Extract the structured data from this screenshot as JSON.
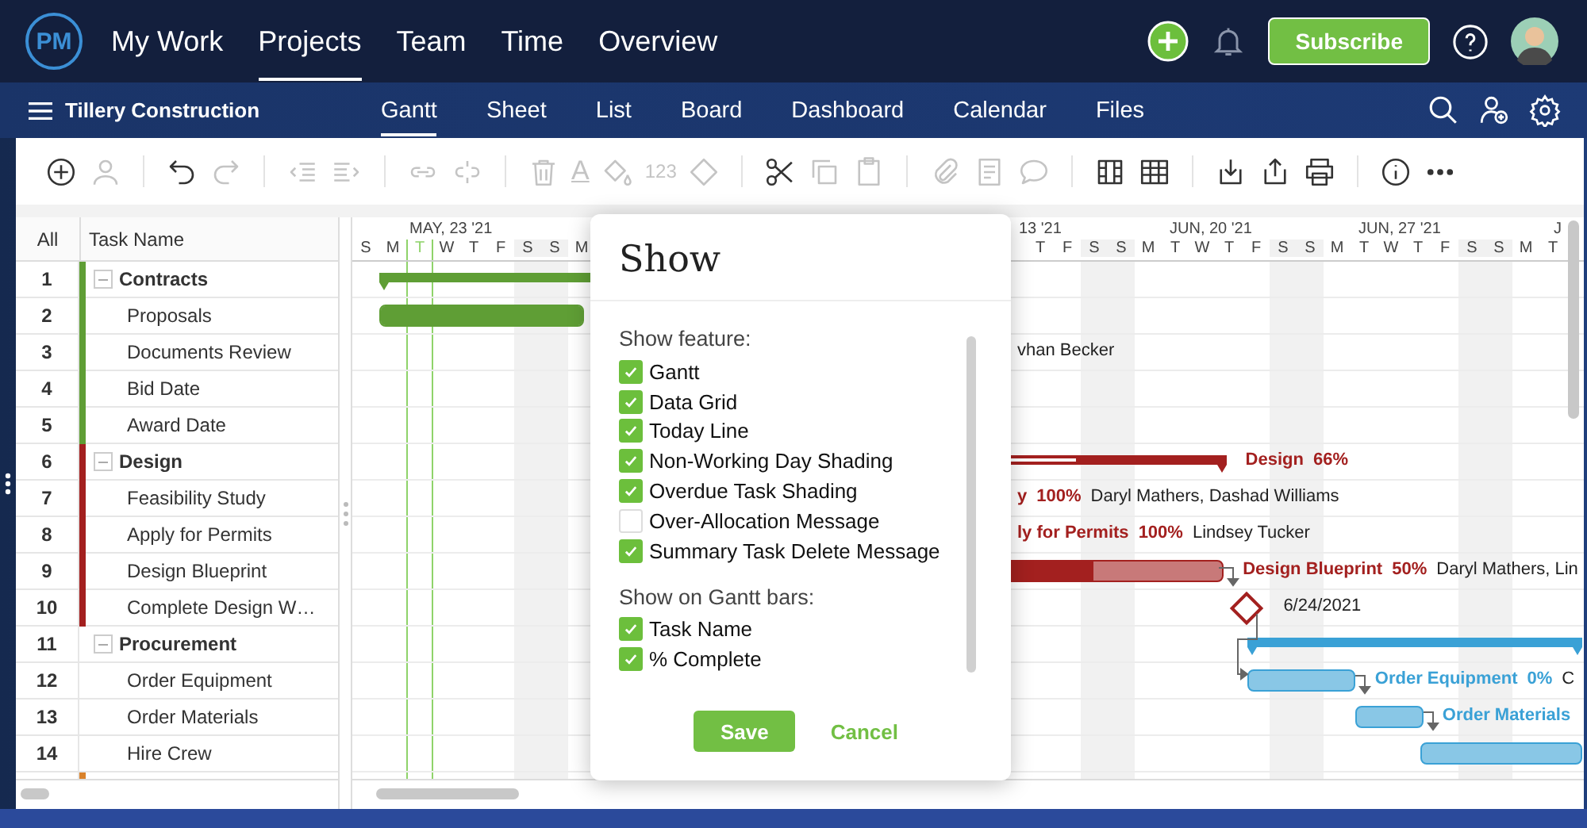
{
  "nav": {
    "logo": "PM",
    "items": [
      {
        "label": "My Work",
        "selected": false
      },
      {
        "label": "Projects",
        "selected": true
      },
      {
        "label": "Team",
        "selected": false
      },
      {
        "label": "Time",
        "selected": false
      },
      {
        "label": "Overview",
        "selected": false
      }
    ],
    "subscribe": "Subscribe"
  },
  "project": {
    "name": "Tillery Construction",
    "tabs": [
      {
        "label": "Gantt",
        "selected": true
      },
      {
        "label": "Sheet",
        "selected": false
      },
      {
        "label": "List",
        "selected": false
      },
      {
        "label": "Board",
        "selected": false
      },
      {
        "label": "Dashboard",
        "selected": false
      },
      {
        "label": "Calendar",
        "selected": false
      },
      {
        "label": "Files",
        "selected": false
      }
    ]
  },
  "toolbar": [
    {
      "items": [
        {
          "kind": "add",
          "disabled": false
        },
        {
          "kind": "assign",
          "disabled": true
        }
      ]
    },
    {
      "items": [
        {
          "kind": "undo",
          "disabled": false
        },
        {
          "kind": "redo",
          "disabled": true
        }
      ]
    },
    {
      "items": [
        {
          "kind": "outdent",
          "disabled": true
        },
        {
          "kind": "indent",
          "disabled": true
        }
      ]
    },
    {
      "items": [
        {
          "kind": "link",
          "disabled": true
        },
        {
          "kind": "unlink",
          "disabled": true
        }
      ]
    },
    {
      "items": [
        {
          "kind": "delete",
          "disabled": true
        },
        {
          "kind": "font",
          "text": "A",
          "disabled": true
        },
        {
          "kind": "bucket",
          "disabled": true
        },
        {
          "kind": "number",
          "text": "123",
          "disabled": true
        },
        {
          "kind": "milestone",
          "disabled": true
        }
      ]
    },
    {
      "items": [
        {
          "kind": "cut",
          "disabled": false
        },
        {
          "kind": "copy",
          "disabled": true
        },
        {
          "kind": "paste",
          "disabled": true
        }
      ]
    },
    {
      "items": [
        {
          "kind": "attach",
          "disabled": true
        },
        {
          "kind": "notes",
          "disabled": true
        },
        {
          "kind": "comment",
          "disabled": true
        }
      ]
    },
    {
      "items": [
        {
          "kind": "columns",
          "disabled": false
        },
        {
          "kind": "table",
          "disabled": false
        }
      ]
    },
    {
      "items": [
        {
          "kind": "import",
          "disabled": false
        },
        {
          "kind": "export",
          "disabled": false
        },
        {
          "kind": "print",
          "disabled": false
        }
      ]
    },
    {
      "items": [
        {
          "kind": "info",
          "disabled": false
        },
        {
          "kind": "more",
          "disabled": false
        }
      ]
    }
  ],
  "grid": {
    "columns": [
      "All",
      "Task Name"
    ],
    "rows": [
      {
        "num": "1",
        "name": "Contracts",
        "kind": "group",
        "expanded": true,
        "color": "#5f9e35"
      },
      {
        "num": "2",
        "name": "Proposals",
        "kind": "task",
        "color": "#5f9e35"
      },
      {
        "num": "3",
        "name": "Documents Review",
        "kind": "task",
        "color": "#5f9e35"
      },
      {
        "num": "4",
        "name": "Bid Date",
        "kind": "task",
        "color": "#5f9e35"
      },
      {
        "num": "5",
        "name": "Award Date",
        "kind": "task",
        "color": "#5f9e35"
      },
      {
        "num": "6",
        "name": "Design",
        "kind": "group",
        "expanded": true,
        "color": "#a3201f"
      },
      {
        "num": "7",
        "name": "Feasibility Study",
        "kind": "task",
        "color": "#a3201f"
      },
      {
        "num": "8",
        "name": "Apply for Permits",
        "kind": "task",
        "color": "#a3201f"
      },
      {
        "num": "9",
        "name": "Design Blueprint",
        "kind": "task",
        "color": "#a3201f"
      },
      {
        "num": "10",
        "name": "Complete Design W…",
        "kind": "task",
        "color": "#a3201f"
      },
      {
        "num": "11",
        "name": "Procurement",
        "kind": "group",
        "expanded": true
      },
      {
        "num": "12",
        "name": "Order Equipment",
        "kind": "task"
      },
      {
        "num": "13",
        "name": "Order Materials",
        "kind": "task"
      },
      {
        "num": "14",
        "name": "Hire Crew",
        "kind": "task"
      }
    ],
    "cut_row": {
      "color": "#d9822b"
    }
  },
  "gantt": {
    "weeks": [
      "MAY, 23 '21",
      "13 '21",
      "JUN, 20 '21",
      "JUN, 27 '21",
      "J"
    ],
    "days_left": [
      {
        "label": "S",
        "weekend": false,
        "today": false
      },
      {
        "label": "M",
        "weekend": false,
        "today": false
      },
      {
        "label": "T",
        "weekend": false,
        "today": true
      },
      {
        "label": "W",
        "weekend": false,
        "today": false
      },
      {
        "label": "T",
        "weekend": false,
        "today": false
      },
      {
        "label": "F",
        "weekend": false,
        "today": false
      },
      {
        "label": "S",
        "weekend": true,
        "today": false
      },
      {
        "label": "S",
        "weekend": true,
        "today": false
      },
      {
        "label": "M",
        "weekend": false,
        "today": false
      }
    ],
    "days_right": [
      {
        "label": "T",
        "weekend": false
      },
      {
        "label": "F",
        "weekend": false
      },
      {
        "label": "S",
        "weekend": true
      },
      {
        "label": "S",
        "weekend": true
      },
      {
        "label": "M",
        "weekend": false
      },
      {
        "label": "T",
        "weekend": false
      },
      {
        "label": "W",
        "weekend": false
      },
      {
        "label": "T",
        "weekend": false
      },
      {
        "label": "F",
        "weekend": false
      },
      {
        "label": "S",
        "weekend": true
      },
      {
        "label": "S",
        "weekend": true
      },
      {
        "label": "M",
        "weekend": false
      },
      {
        "label": "T",
        "weekend": false
      },
      {
        "label": "W",
        "weekend": false
      },
      {
        "label": "T",
        "weekend": false
      },
      {
        "label": "F",
        "weekend": false
      },
      {
        "label": "S",
        "weekend": true
      },
      {
        "label": "S",
        "weekend": true
      },
      {
        "label": "M",
        "weekend": false
      },
      {
        "label": "T",
        "weekend": false
      }
    ],
    "rows": [
      {
        "kind": "summary",
        "color": "#5f9e35"
      },
      {
        "kind": "task",
        "color": "#5f9e35",
        "level": 1
      },
      {
        "kind": "text",
        "resources": "vhan Becker"
      },
      {
        "kind": "empty"
      },
      {
        "kind": "empty"
      },
      {
        "kind": "summary",
        "color": "#a3201f",
        "level": 0.66,
        "label": "Design",
        "percent": "66%"
      },
      {
        "kind": "text",
        "color": "#a3201f",
        "label": "y",
        "percent": "100%",
        "resources": "Daryl Mathers, Dashad Williams"
      },
      {
        "kind": "text",
        "color": "#a3201f",
        "label": "ly for Permits",
        "percent": "100%",
        "resources": "Lindsey Tucker"
      },
      {
        "kind": "task",
        "color": "#a3201f",
        "level": 0.5,
        "label": "Design Blueprint",
        "percent": "50%",
        "resources": "Daryl Mathers, Lin"
      },
      {
        "kind": "milestone",
        "color": "#a3201f",
        "date": "6/24/2021"
      },
      {
        "kind": "summary",
        "color": "#3aa1d6"
      },
      {
        "kind": "task",
        "color": "#3aa1d6",
        "label": "Order Equipment",
        "percent": "0%",
        "resources": "C"
      },
      {
        "kind": "task",
        "color": "#3aa1d6",
        "label": "Order Materials"
      },
      {
        "kind": "task",
        "color": "#3aa1d6"
      }
    ]
  },
  "dialog": {
    "title": "Show",
    "sections": [
      {
        "heading": "Show feature:",
        "options": [
          {
            "label": "Gantt",
            "checked": true
          },
          {
            "label": "Data Grid",
            "checked": true
          },
          {
            "label": "Today Line",
            "checked": true
          },
          {
            "label": "Non-Working Day Shading",
            "checked": true
          },
          {
            "label": "Overdue Task Shading",
            "checked": true
          },
          {
            "label": "Over-Allocation Message",
            "checked": false
          },
          {
            "label": "Summary Task Delete Message",
            "checked": true
          }
        ]
      },
      {
        "heading": "Show on Gantt bars:",
        "options": [
          {
            "label": "Task Name",
            "checked": true
          },
          {
            "label": "% Complete",
            "checked": true
          }
        ]
      }
    ],
    "save": "Save",
    "cancel": "Cancel"
  }
}
